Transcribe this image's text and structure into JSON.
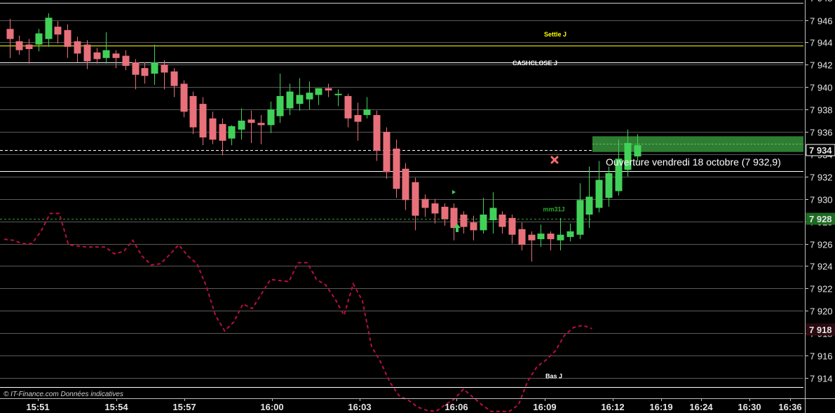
{
  "chart_data": {
    "type": "candlestick",
    "y_axis": {
      "range": [
        7913,
        7950
      ],
      "ticks": [
        "7 946",
        "7 944",
        "7 942",
        "7 940",
        "7 938",
        "7 936",
        "7 934",
        "7 932",
        "7 930",
        "7 928",
        "7 926",
        "7 924",
        "7 922",
        "7 920",
        "7 918",
        "7 916",
        "7 914"
      ],
      "top_partial_tick": "7 948"
    },
    "x_axis": {
      "ticks": [
        "15:51",
        "15:54",
        "15:57",
        "16:00",
        "16:03",
        "16:06",
        "16:09",
        "16:12",
        "16:19",
        "16:24",
        "16:30",
        "16:36"
      ]
    },
    "grid": "horizontal",
    "candles": [
      {
        "o": 7945.2,
        "h": 7946.1,
        "l": 7942.6,
        "c": 7944.3
      },
      {
        "o": 7944.1,
        "h": 7944.6,
        "l": 7942.9,
        "c": 7943.3
      },
      {
        "o": 7943.8,
        "h": 7944.3,
        "l": 7942.1,
        "c": 7943.4
      },
      {
        "o": 7943.8,
        "h": 7945.2,
        "l": 7943.2,
        "c": 7944.8
      },
      {
        "o": 7944.3,
        "h": 7946.6,
        "l": 7943.6,
        "c": 7946.2
      },
      {
        "o": 7945.4,
        "h": 7945.9,
        "l": 7943.9,
        "c": 7944.7
      },
      {
        "o": 7945.1,
        "h": 7945.6,
        "l": 7942.6,
        "c": 7943.6
      },
      {
        "o": 7944.1,
        "h": 7944.5,
        "l": 7942.2,
        "c": 7943.0
      },
      {
        "o": 7943.8,
        "h": 7944.2,
        "l": 7941.6,
        "c": 7942.3
      },
      {
        "o": 7943.1,
        "h": 7943.5,
        "l": 7942.1,
        "c": 7942.5
      },
      {
        "o": 7942.6,
        "h": 7944.9,
        "l": 7942.1,
        "c": 7943.3
      },
      {
        "o": 7943.0,
        "h": 7943.3,
        "l": 7941.7,
        "c": 7942.6
      },
      {
        "o": 7942.8,
        "h": 7943.3,
        "l": 7941.5,
        "c": 7941.9
      },
      {
        "o": 7942.2,
        "h": 7942.5,
        "l": 7939.8,
        "c": 7941.1
      },
      {
        "o": 7941.7,
        "h": 7942.2,
        "l": 7940.3,
        "c": 7941.0
      },
      {
        "o": 7941.2,
        "h": 7943.8,
        "l": 7940.2,
        "c": 7942.2
      },
      {
        "o": 7942.0,
        "h": 7942.4,
        "l": 7939.8,
        "c": 7941.3
      },
      {
        "o": 7941.4,
        "h": 7941.7,
        "l": 7939.1,
        "c": 7940.1
      },
      {
        "o": 7940.3,
        "h": 7940.6,
        "l": 7937.3,
        "c": 7937.8
      },
      {
        "o": 7939.2,
        "h": 7939.6,
        "l": 7935.8,
        "c": 7936.4
      },
      {
        "o": 7938.5,
        "h": 7939.1,
        "l": 7934.8,
        "c": 7935.5
      },
      {
        "o": 7937.2,
        "h": 7937.8,
        "l": 7934.9,
        "c": 7935.3
      },
      {
        "o": 7936.7,
        "h": 7937.2,
        "l": 7933.9,
        "c": 7935.2
      },
      {
        "o": 7935.4,
        "h": 7936.6,
        "l": 7934.8,
        "c": 7936.5
      },
      {
        "o": 7936.2,
        "h": 7938.1,
        "l": 7935.3,
        "c": 7937.0
      },
      {
        "o": 7937.1,
        "h": 7937.9,
        "l": 7935.0,
        "c": 7936.8
      },
      {
        "o": 7936.8,
        "h": 7937.5,
        "l": 7934.9,
        "c": 7936.6
      },
      {
        "o": 7936.6,
        "h": 7938.7,
        "l": 7935.9,
        "c": 7938.0
      },
      {
        "o": 7937.4,
        "h": 7941.2,
        "l": 7936.8,
        "c": 7939.2
      },
      {
        "o": 7938.1,
        "h": 7940.3,
        "l": 7937.5,
        "c": 7939.6
      },
      {
        "o": 7938.5,
        "h": 7940.8,
        "l": 7937.9,
        "c": 7939.3
      },
      {
        "o": 7938.9,
        "h": 7940.5,
        "l": 7938.0,
        "c": 7939.5
      },
      {
        "o": 7939.3,
        "h": 7939.4,
        "l": 7938.4,
        "c": 7939.9
      },
      {
        "o": 7939.9,
        "h": 7940.3,
        "l": 7939.1,
        "c": 7939.7
      },
      {
        "o": 7939.3,
        "h": 7939.8,
        "l": 7938.3,
        "c": 7939.4
      },
      {
        "o": 7939.2,
        "h": 7939.4,
        "l": 7936.4,
        "c": 7937.2
      },
      {
        "o": 7937.5,
        "h": 7938.6,
        "l": 7935.2,
        "c": 7936.9
      },
      {
        "o": 7937.5,
        "h": 7939.1,
        "l": 7937.2,
        "c": 7938.0
      },
      {
        "o": 7937.5,
        "h": 7937.9,
        "l": 7933.4,
        "c": 7934.3
      },
      {
        "o": 7936.0,
        "h": 7936.4,
        "l": 7931.8,
        "c": 7932.4
      },
      {
        "o": 7934.5,
        "h": 7935.3,
        "l": 7930.1,
        "c": 7930.9
      },
      {
        "o": 7932.7,
        "h": 7933.2,
        "l": 7929.0,
        "c": 7929.9
      },
      {
        "o": 7931.5,
        "h": 7931.9,
        "l": 7927.2,
        "c": 7928.5
      },
      {
        "o": 7930.0,
        "h": 7930.4,
        "l": 7928.4,
        "c": 7929.2
      },
      {
        "o": 7929.6,
        "h": 7930.0,
        "l": 7927.8,
        "c": 7928.7
      },
      {
        "o": 7929.3,
        "h": 7929.6,
        "l": 7927.6,
        "c": 7928.2
      },
      {
        "o": 7929.2,
        "h": 7929.6,
        "l": 7926.3,
        "c": 7927.4
      },
      {
        "o": 7928.6,
        "h": 7928.9,
        "l": 7926.9,
        "c": 7927.5
      },
      {
        "o": 7927.9,
        "h": 7928.5,
        "l": 7926.3,
        "c": 7927.2
      },
      {
        "o": 7927.2,
        "h": 7930.1,
        "l": 7926.9,
        "c": 7928.6
      },
      {
        "o": 7928.1,
        "h": 7930.6,
        "l": 7926.9,
        "c": 7929.2
      },
      {
        "o": 7928.6,
        "h": 7928.9,
        "l": 7926.9,
        "c": 7927.5
      },
      {
        "o": 7928.3,
        "h": 7928.6,
        "l": 7926.0,
        "c": 7926.8
      },
      {
        "o": 7927.3,
        "h": 7927.9,
        "l": 7925.4,
        "c": 7925.9
      },
      {
        "o": 7926.8,
        "h": 7927.1,
        "l": 7924.4,
        "c": 7926.3
      },
      {
        "o": 7926.4,
        "h": 7927.7,
        "l": 7925.7,
        "c": 7926.9
      },
      {
        "o": 7926.9,
        "h": 7927.1,
        "l": 7925.4,
        "c": 7926.4
      },
      {
        "o": 7926.3,
        "h": 7928.3,
        "l": 7925.4,
        "c": 7926.8
      },
      {
        "o": 7926.6,
        "h": 7927.8,
        "l": 7926.2,
        "c": 7927.1
      },
      {
        "o": 7926.8,
        "h": 7931.4,
        "l": 7926.4,
        "c": 7929.9
      },
      {
        "o": 7928.6,
        "h": 7932.9,
        "l": 7927.4,
        "c": 7930.2
      },
      {
        "o": 7929.2,
        "h": 7933.4,
        "l": 7928.8,
        "c": 7931.7
      },
      {
        "o": 7930.1,
        "h": 7932.9,
        "l": 7929.3,
        "c": 7932.3
      },
      {
        "o": 7930.7,
        "h": 7935.3,
        "l": 7930.3,
        "c": 7933.6
      },
      {
        "o": 7932.6,
        "h": 7936.2,
        "l": 7932.0,
        "c": 7935.0
      },
      {
        "o": 7933.8,
        "h": 7935.8,
        "l": 7933.3,
        "c": 7934.8
      }
    ],
    "levels": [
      {
        "name": "Settle J",
        "value": 7943.7,
        "color": "#ffff00",
        "style": "solid"
      },
      {
        "name": "CASHCLOSE J",
        "value": 7942.2,
        "color": "#ffffff",
        "style": "solid"
      },
      {
        "name": "mm31J",
        "value": 7928.2,
        "color": "#2e9b2e",
        "style": "dashed"
      },
      {
        "name": "Bas J",
        "value": 7913.2,
        "color": "#ffffff",
        "style": "solid"
      }
    ],
    "last_price": {
      "label": "7 934",
      "value": 7934.4
    },
    "green_marker": {
      "label": "7 928",
      "value": 7928.2
    },
    "red_marker": {
      "label": "7 918",
      "value": 7918.3
    },
    "opening_annotation": {
      "text": "Ouverture vendredi 18 octobre (7 932,9)",
      "value": 7932.9
    },
    "colors": {
      "up": "#41d158",
      "down": "#e8707a",
      "grid": "#5a5a5a",
      "dashed_series": "#b8103e",
      "background": "#000000",
      "opening_band": "#2e7d32"
    },
    "dashed_series": {
      "name": "",
      "values": [
        7926.4,
        7926.3,
        7926.0,
        7926.0,
        7927.1,
        7928.7,
        7928.7,
        7925.9,
        7925.8,
        7925.7,
        7925.7,
        7925.7,
        7925.1,
        7925.3,
        7926.3,
        7924.9,
        7924.1,
        7924.2,
        7925.0,
        7925.9,
        7924.9,
        7924.2,
        7922.2,
        7919.6,
        7918.2,
        7919.0,
        7920.6,
        7920.2,
        7921.5,
        7922.8,
        7922.7,
        7922.6,
        7924.3,
        7924.3,
        7922.8,
        7922.3,
        7921.1,
        7919.6,
        7922.4,
        7920.9,
        7916.8,
        7915.4,
        7913.6,
        7912.4,
        7912.0,
        7911.4,
        7911.1,
        7911.0,
        7911.6,
        7912.1,
        7913.0,
        7912.3,
        7911.6,
        7911.0,
        7911.0,
        7911.0,
        7911.6,
        7913.7,
        7915.0,
        7915.6,
        7916.4,
        7917.8,
        7918.5,
        7918.7,
        7918.4
      ]
    },
    "credit": "© IT-Finance.com  Données indicatives"
  }
}
